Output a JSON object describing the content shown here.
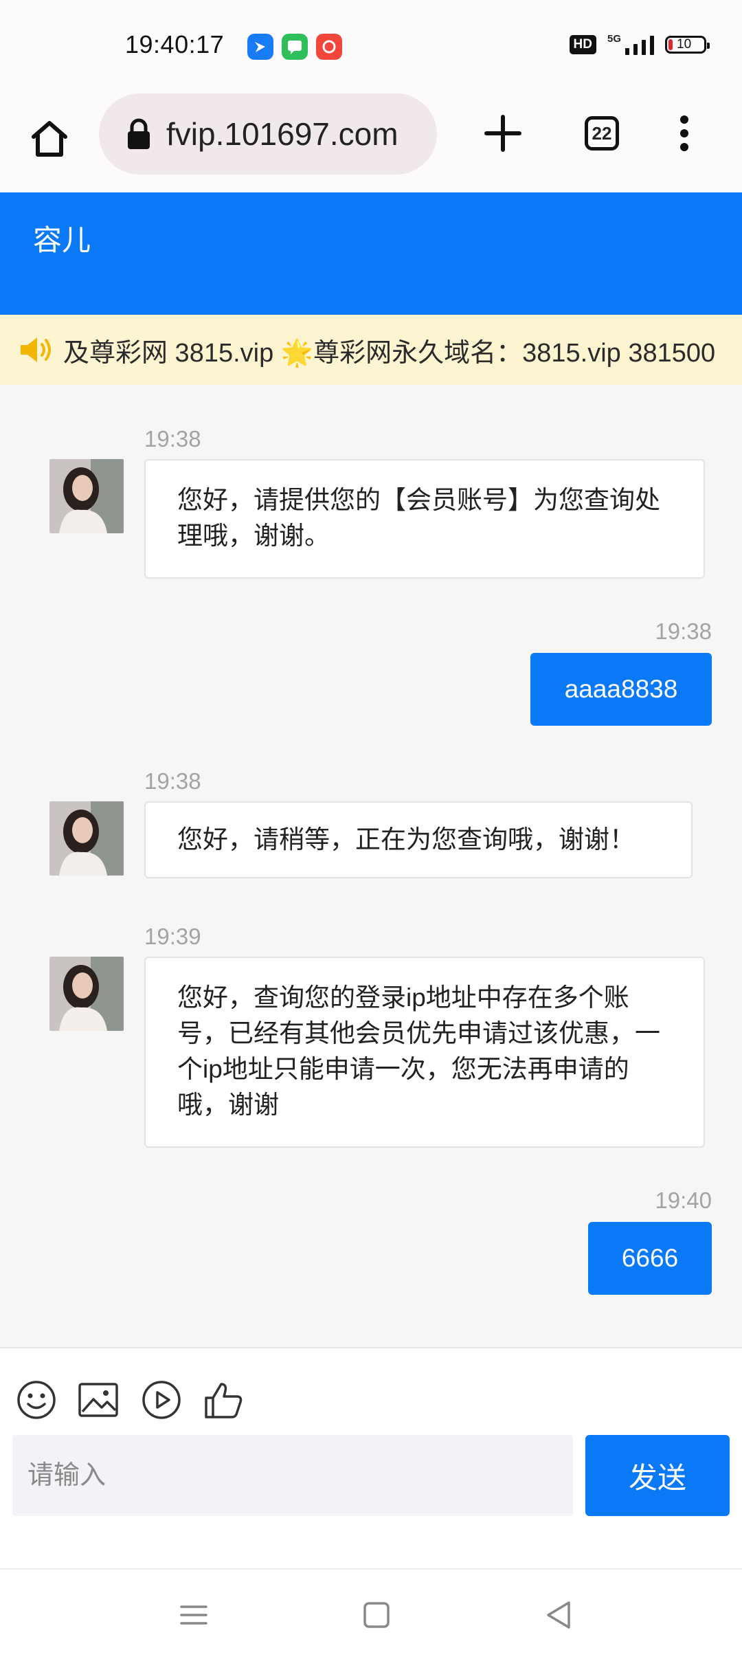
{
  "status_bar": {
    "time": "19:40:17",
    "hd": "HD",
    "network": "5G",
    "battery": "10",
    "battery_level": 0.1
  },
  "browser": {
    "url": "fvip.101697.com",
    "tab_count": "22"
  },
  "chat_header": {
    "agent_name": "容儿"
  },
  "notice": {
    "text": "及尊彩网 3815.vip 🌟尊彩网永久域名：3815.vip 381500"
  },
  "messages": [
    {
      "time": "19:38",
      "from": "agent",
      "text": "您好，请提供您的【会员账号】为您查询处理哦，谢谢。"
    },
    {
      "time": "19:38",
      "from": "user",
      "text": "aaaa8838"
    },
    {
      "time": "19:38",
      "from": "agent",
      "text": "您好，请稍等，正在为您查询哦，谢谢！"
    },
    {
      "time": "19:39",
      "from": "agent",
      "text": "您好，查询您的登录ip地址中存在多个账号，已经有其他会员优先申请过该优惠，一个ip地址只能申请一次，您无法再申请的哦，谢谢"
    },
    {
      "time": "19:40",
      "from": "user",
      "text": "6666"
    }
  ],
  "input": {
    "placeholder": "请输入",
    "value": "",
    "send_label": "发送"
  },
  "tools": [
    "emoji-icon",
    "image-icon",
    "video-icon",
    "thumbs-up-icon"
  ],
  "colors": {
    "accent": "#0a79f8",
    "notice_bg": "#fdf5d2"
  }
}
